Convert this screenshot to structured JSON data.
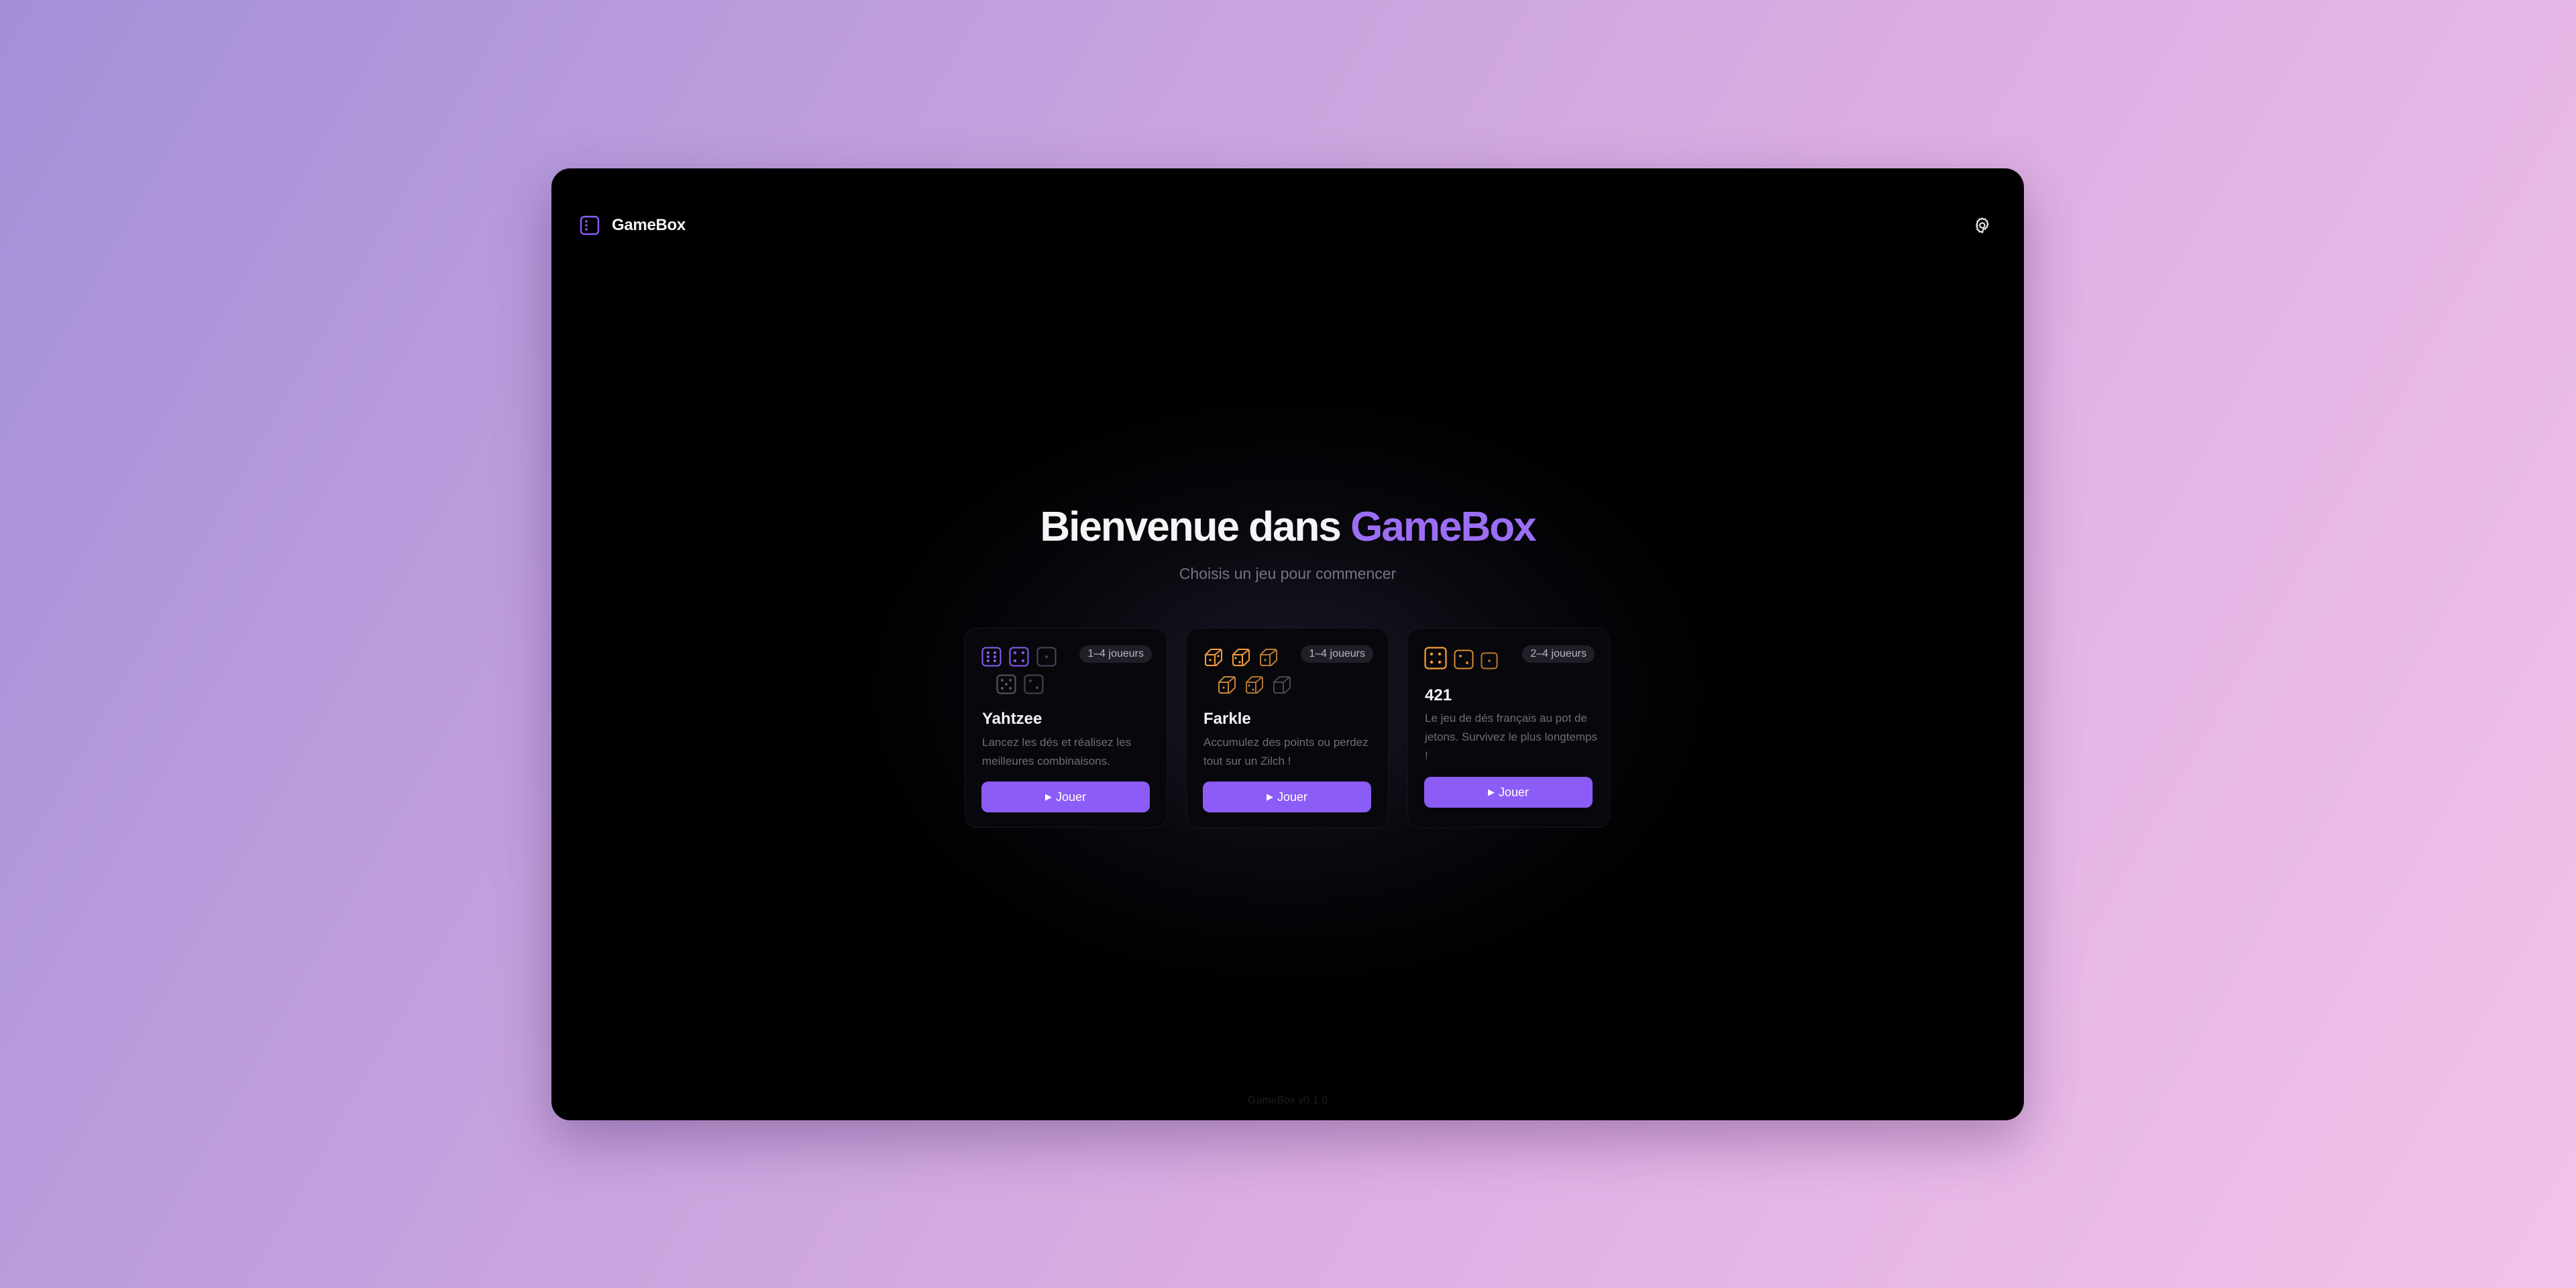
{
  "app": {
    "name": "GameBox",
    "settings_icon": "gear-icon",
    "logo_icon": "dice-logo-icon"
  },
  "hero": {
    "title_prefix": "Bienvenue dans",
    "title_accent": "GameBox",
    "subtitle": "Choisis un jeu pour commencer"
  },
  "games": [
    {
      "title": "Yahtzee",
      "players": "1–4 joueurs",
      "description": "Lancez les dés et réalisez les meilleures combinaisons.",
      "play_label": "Jouer",
      "icon": "five-dice-icon",
      "accent_color": "#8b5cf6"
    },
    {
      "title": "Farkle",
      "players": "1–4 joueurs",
      "description": "Accumulez des points ou perdez tout sur un Zilch !",
      "play_label": "Jouer",
      "icon": "six-dice-icon",
      "accent_color": "#f59e3a"
    },
    {
      "title": "421",
      "players": "2–4 joueurs",
      "description": "Le jeu de dés français au pot de jetons. Survivez le plus longtemps !",
      "play_label": "Jouer",
      "icon": "three-dice-icon",
      "accent_color": "#f59e3a"
    }
  ],
  "footer": {
    "version": "GameBox v0.1.0"
  },
  "colors": {
    "accent": "#8b5cf6",
    "accent_text": "#9c6ef5",
    "background": "#000000",
    "dice_orange": "#f59e3a"
  }
}
